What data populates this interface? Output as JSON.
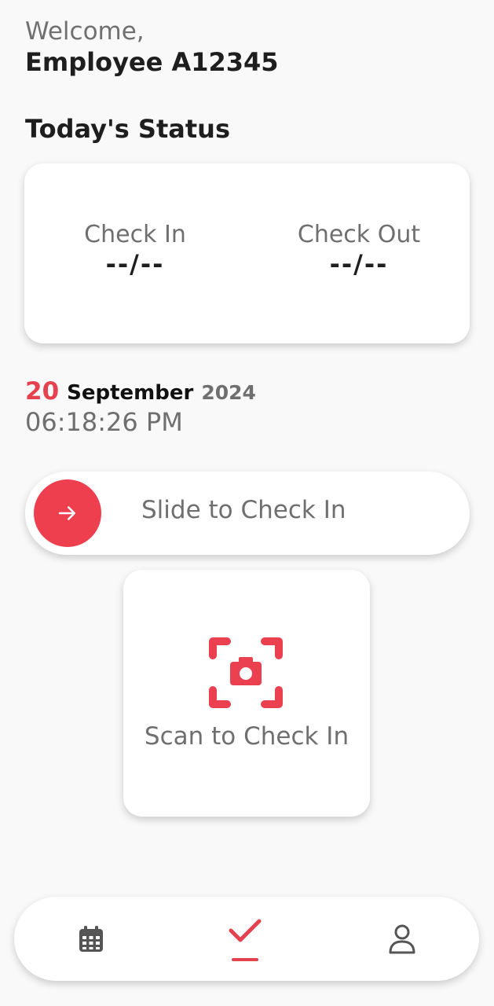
{
  "header": {
    "welcome": "Welcome,",
    "employee": "Employee A12345"
  },
  "status": {
    "title": "Today's Status",
    "check_in_label": "Check In",
    "check_in_value": "--/--",
    "check_out_label": "Check Out",
    "check_out_value": "--/--"
  },
  "datetime": {
    "day": "20",
    "month": "September",
    "year": "2024",
    "time": "06:18:26 PM"
  },
  "slider": {
    "label": "Slide to Check In",
    "knob_icon": "arrow-right-icon"
  },
  "scan": {
    "label": "Scan to Check In",
    "icon": "camera-scan-icon"
  },
  "nav": {
    "items": [
      {
        "icon": "calendar-icon",
        "active": false
      },
      {
        "icon": "check-icon",
        "active": true
      },
      {
        "icon": "user-icon",
        "active": false
      }
    ]
  },
  "colors": {
    "accent": "#e5414f",
    "background": "#f9f9f9",
    "card": "#ffffff",
    "muted_text": "#6f6f6f"
  }
}
